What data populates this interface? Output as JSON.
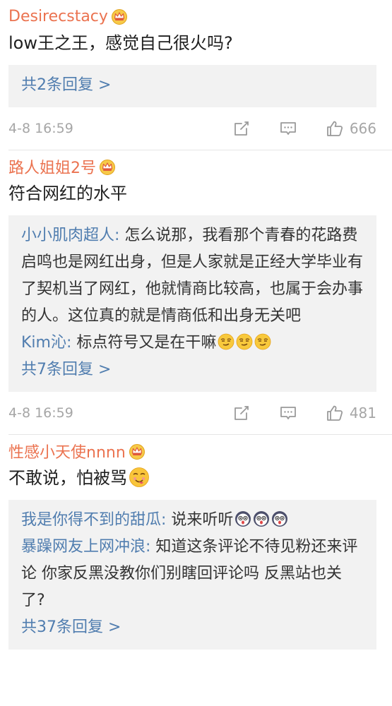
{
  "comments": [
    {
      "username": "Desirecstacy",
      "text": "low王之王，感觉自己很火吗?",
      "replies": [],
      "more_replies": "共2条回复 >",
      "time": "4-8 16:59",
      "likes": "666"
    },
    {
      "username": "路人姐姐2号",
      "text": "符合网红的水平",
      "replies": [
        {
          "user": "小小肌肉超人:",
          "text": " 怎么说那，我看那个青春的花路费启鸣也是网红出身，但是人家就是正经大学毕业有了契机当了网红，他就情商比较高，也属于会办事的人。这位真的就是情商低和出身无关吧"
        },
        {
          "user": "Kim沁:",
          "text": " 标点符号又是在干嘛"
        }
      ],
      "more_replies": "共7条回复 >",
      "time": "4-8 16:59",
      "likes": "481"
    },
    {
      "username": "性感小天使nnnn",
      "text": "不敢说，怕被骂",
      "replies": [
        {
          "user": "我是你得不到的甜瓜:",
          "text": " 说来听听"
        },
        {
          "user": "暴躁网友上网冲浪:",
          "text": " 知道这条评论不待见粉还来评论 你家反黑没教你们别瞎回评论吗 反黑站也关了?"
        }
      ],
      "more_replies": "共37条回复 >"
    }
  ],
  "colors": {
    "username": "#eb7350",
    "link": "#507daf",
    "meta": "#a6a6a6",
    "reply_bg": "#f2f2f2"
  },
  "icons": [
    "crown-icon",
    "share-icon",
    "comment-icon",
    "like-icon",
    "smirk-emoji",
    "shocked-emoji",
    "yum-emoji"
  ]
}
